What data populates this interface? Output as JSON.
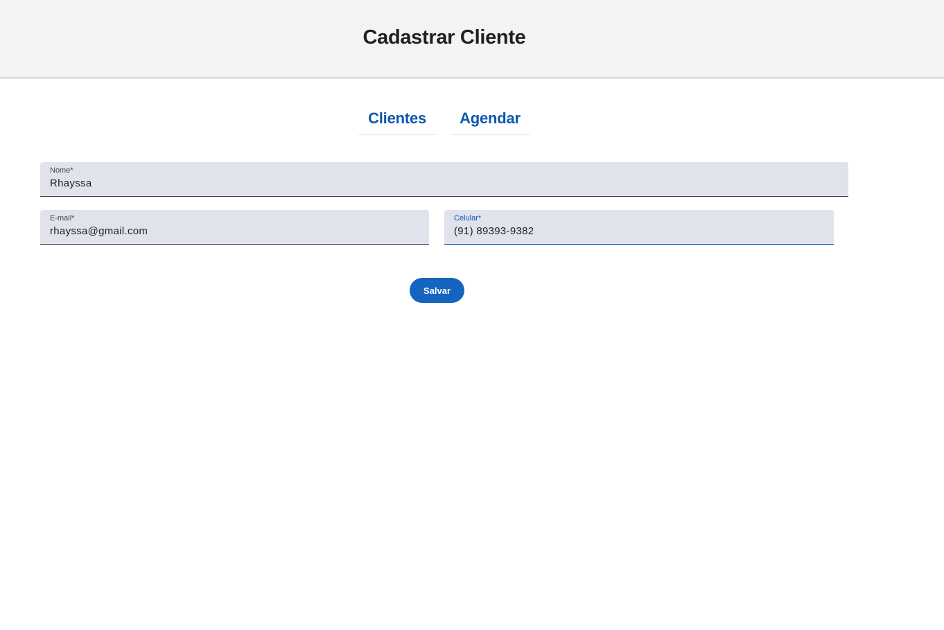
{
  "header": {
    "title": "Cadastrar Cliente"
  },
  "nav": {
    "items": [
      {
        "label": "Clientes"
      },
      {
        "label": "Agendar"
      }
    ]
  },
  "form": {
    "nome": {
      "label": "Nome*",
      "value": "Rhayssa"
    },
    "email": {
      "label": "E-mail*",
      "value": "rhayssa@gmail.com"
    },
    "celular": {
      "label": "Celular*",
      "value": "(91) 89393-9382"
    },
    "save_label": "Salvar"
  },
  "colors": {
    "accent": "#0b57b0",
    "button": "#1565c0",
    "field_bg": "#e0e2ec",
    "header_bg": "#f3f3f5"
  }
}
